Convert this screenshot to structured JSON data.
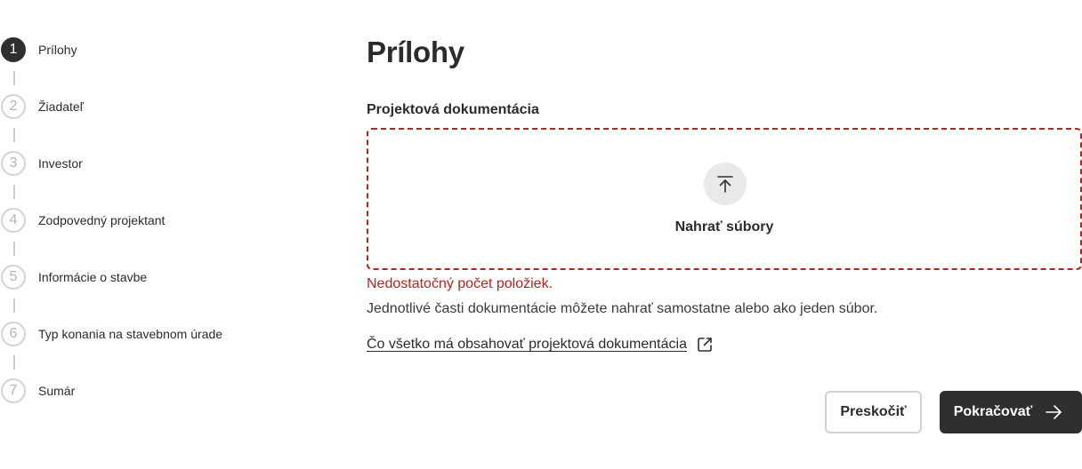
{
  "stepper": {
    "steps": [
      {
        "number": "1",
        "label": "Prílohy",
        "active": true
      },
      {
        "number": "2",
        "label": "Žiadateľ",
        "active": false
      },
      {
        "number": "3",
        "label": "Investor",
        "active": false
      },
      {
        "number": "4",
        "label": "Zodpovedný projektant",
        "active": false
      },
      {
        "number": "5",
        "label": "Informácie o stavbe",
        "active": false
      },
      {
        "number": "6",
        "label": "Typ konania na stavebnom úrade",
        "active": false
      },
      {
        "number": "7",
        "label": "Sumár",
        "active": false
      }
    ]
  },
  "main": {
    "title": "Prílohy",
    "section_label": "Projektová dokumentácia",
    "upload": {
      "label": "Nahrať súbory",
      "icon": "upload-icon"
    },
    "error": "Nedostatočný počet položiek.",
    "hint": "Jednotlivé časti dokumentácie môžete nahrať samostatne alebo ako jeden súbor.",
    "help_link": {
      "label": "Čo všetko má obsahovať projektová dokumentácia",
      "icon": "external-link-icon"
    }
  },
  "actions": {
    "skip_label": "Preskočiť",
    "continue_label": "Pokračovať",
    "continue_icon": "arrow-right-icon"
  },
  "colors": {
    "error": "#b3261e",
    "primary": "#2f2f2f",
    "step_inactive": "#d4d4d4"
  }
}
